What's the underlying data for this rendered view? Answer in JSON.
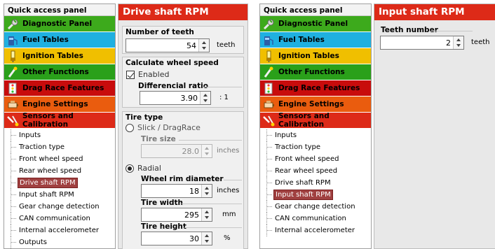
{
  "left": {
    "quick_access": {
      "title": "Quick access panel",
      "items": [
        {
          "label": "Diagnostic Panel",
          "bg": "#3daa1c",
          "icon": "wrench-icon"
        },
        {
          "label": "Fuel Tables",
          "bg": "#1fb0e0",
          "icon": "fuel-icon"
        },
        {
          "label": "Ignition Tables",
          "bg": "#f0bf00",
          "icon": "ignition-icon"
        },
        {
          "label": "Other Functions",
          "bg": "#2aa01a",
          "icon": "functions-icon"
        },
        {
          "label": "Drag Race Features",
          "bg": "#c80c0c",
          "icon": "drag-race-icon"
        },
        {
          "label": "Engine Settings",
          "bg": "#ea5c0e",
          "icon": "engine-icon"
        },
        {
          "label": "Sensors and Calibration",
          "bg": "#dd2a18",
          "icon": "sensor-icon"
        }
      ]
    },
    "tree": [
      "Inputs",
      "Traction type",
      "Front wheel speed",
      "Rear wheel speed",
      "Drive shaft RPM",
      "Input shaft RPM",
      "Gear change detection",
      "CAN communication",
      "Internal accelerometer",
      "Outputs"
    ],
    "tree_selected": "Drive shaft RPM"
  },
  "drive": {
    "title": "Drive shaft RPM",
    "teeth": {
      "label": "Number of teeth",
      "value": "54",
      "unit": "teeth"
    },
    "wheel": {
      "label": "Calculate wheel speed",
      "enabled_label": "Enabled",
      "ratio_label": "Differencial ratio",
      "ratio_value": "3.90",
      "ratio_unit": ": 1"
    },
    "tire": {
      "label": "Tire type",
      "slick_label": "Slick / DragRace",
      "size_label": "Tire size",
      "size_value": "28.0",
      "size_unit": "inches",
      "radial_label": "Radial",
      "rim_label": "Wheel rim diameter",
      "rim_value": "18",
      "rim_unit": "inches",
      "width_label": "Tire width",
      "width_value": "295",
      "width_unit": "mm",
      "height_label": "Tire height",
      "height_value": "30",
      "height_unit": "%"
    }
  },
  "right": {
    "quick_access": {
      "title": "Quick access panel",
      "items": [
        {
          "label": "Diagnostic Panel",
          "bg": "#3daa1c",
          "icon": "wrench-icon"
        },
        {
          "label": "Fuel Tables",
          "bg": "#1fb0e0",
          "icon": "fuel-icon"
        },
        {
          "label": "Ignition Tables",
          "bg": "#f0bf00",
          "icon": "ignition-icon"
        },
        {
          "label": "Other Functions",
          "bg": "#2aa01a",
          "icon": "functions-icon"
        },
        {
          "label": "Drag Race Features",
          "bg": "#c80c0c",
          "icon": "drag-race-icon"
        },
        {
          "label": "Engine Settings",
          "bg": "#ea5c0e",
          "icon": "engine-icon"
        },
        {
          "label": "Sensors and Calibration",
          "bg": "#dd2a18",
          "icon": "sensor-icon"
        }
      ]
    },
    "tree": [
      "Inputs",
      "Traction type",
      "Front wheel speed",
      "Rear wheel speed",
      "Drive shaft RPM",
      "Input shaft RPM",
      "Gear change detection",
      "CAN communication",
      "Internal accelerometer"
    ],
    "tree_selected": "Input shaft RPM"
  },
  "input": {
    "title": "Input shaft RPM",
    "teeth": {
      "label": "Teeth number",
      "value": "2",
      "unit": "teeth"
    }
  }
}
